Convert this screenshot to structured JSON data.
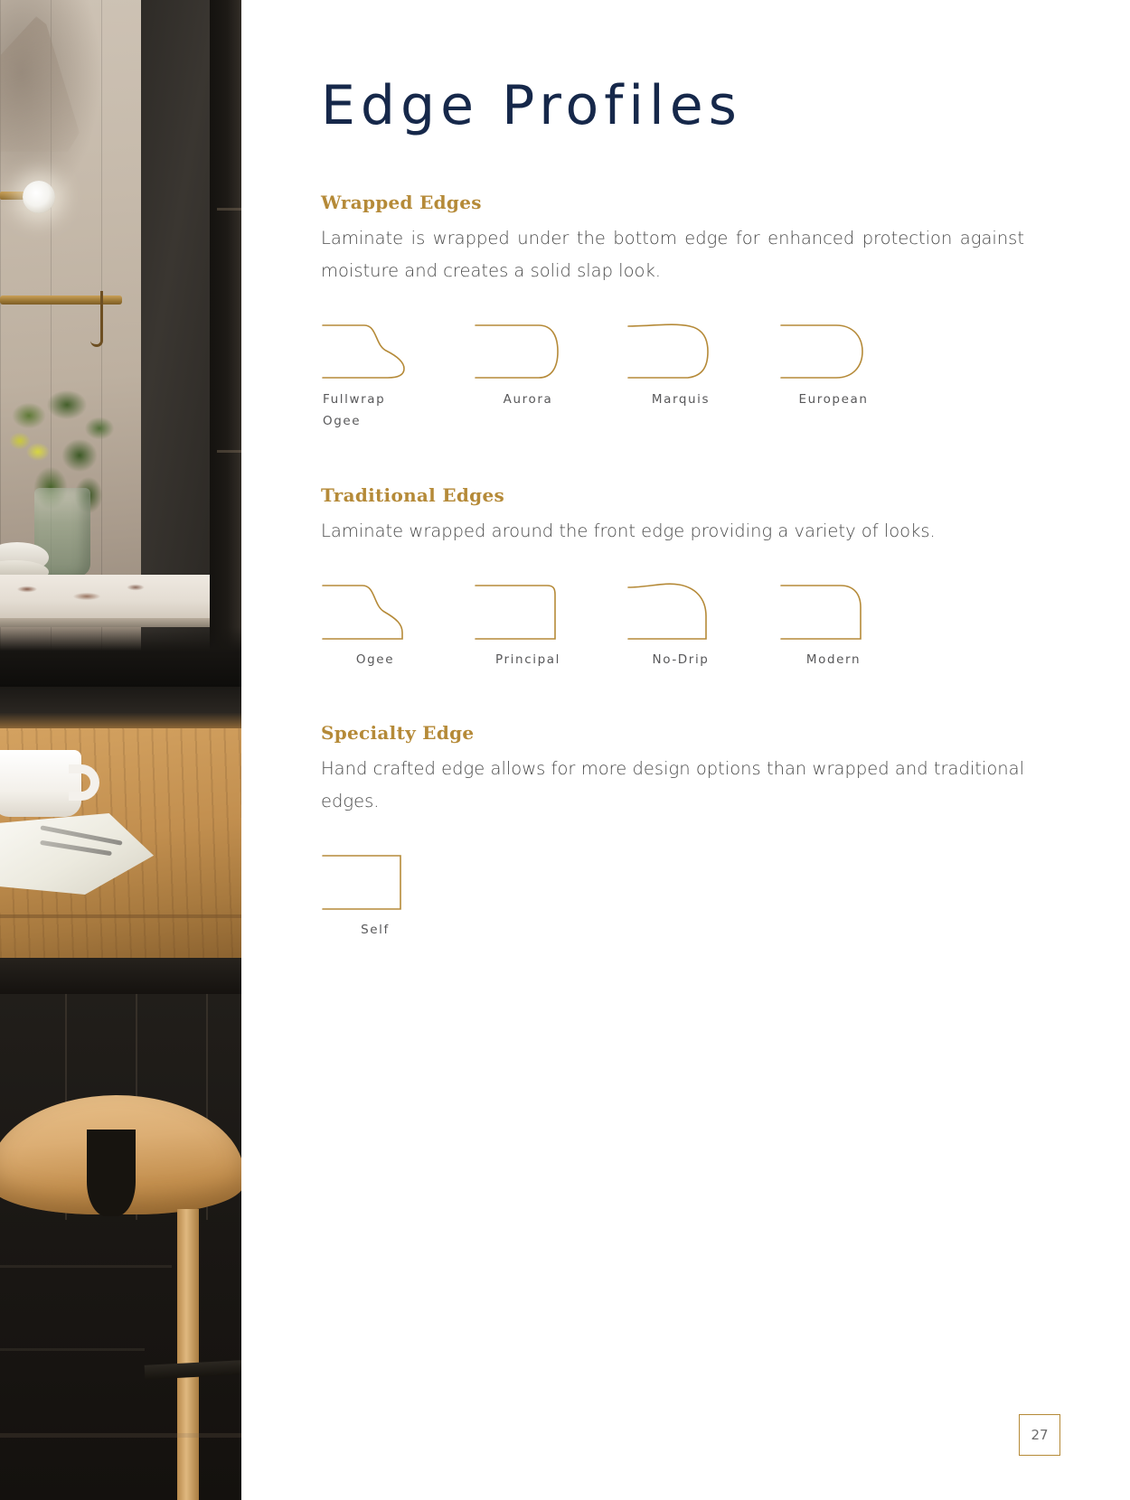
{
  "page": {
    "title": "Edge Profiles",
    "number": "27",
    "accent_gold": "#b58a38",
    "title_navy": "#16284a",
    "body_gray": "#4a4a4a",
    "profile_line_color": "#b58a38"
  },
  "photo": {
    "alt": "kitchen-interior-photo-strip"
  },
  "sections": [
    {
      "id": "wrapped",
      "heading": "Wrapped Edges",
      "body": "Laminate is wrapped under the bottom edge for enhanced protection against moisture and creates a solid slap look.",
      "profiles": [
        {
          "label_line1": "Fullwrap",
          "label_line2": "Ogee",
          "shape": "fullwrap-ogee"
        },
        {
          "label_line1": "Aurora",
          "label_line2": "",
          "shape": "aurora"
        },
        {
          "label_line1": "Marquis",
          "label_line2": "",
          "shape": "marquis"
        },
        {
          "label_line1": "European",
          "label_line2": "",
          "shape": "european"
        }
      ]
    },
    {
      "id": "traditional",
      "heading": "Traditional Edges",
      "body": "Laminate wrapped around the front edge providing a variety of looks.",
      "profiles": [
        {
          "label_line1": "Ogee",
          "label_line2": "",
          "shape": "ogee"
        },
        {
          "label_line1": "Principal",
          "label_line2": "",
          "shape": "principal"
        },
        {
          "label_line1": "No-Drip",
          "label_line2": "",
          "shape": "no-drip"
        },
        {
          "label_line1": "Modern",
          "label_line2": "",
          "shape": "modern"
        }
      ]
    },
    {
      "id": "specialty",
      "heading": "Specialty Edge",
      "body": "Hand crafted edge allows for more design options than wrapped and traditional edges.",
      "profiles": [
        {
          "label_line1": "Self",
          "label_line2": "",
          "shape": "self"
        }
      ]
    }
  ]
}
